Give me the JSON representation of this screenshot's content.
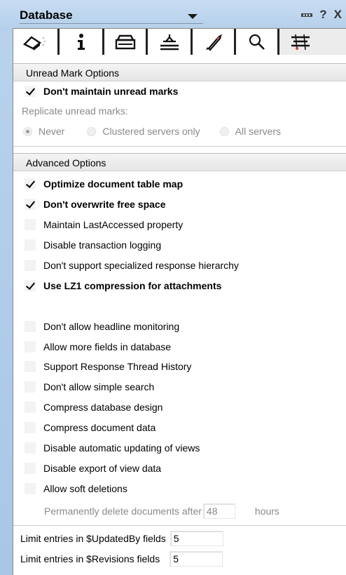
{
  "header": {
    "title": "Database",
    "help": "?",
    "close": "X"
  },
  "tabs": [
    {
      "icon": "info-tab-eraser-icon"
    },
    {
      "icon": "info-icon"
    },
    {
      "icon": "printer-icon"
    },
    {
      "icon": "design-icon"
    },
    {
      "icon": "rocket-icon"
    },
    {
      "icon": "search-icon"
    },
    {
      "icon": "advanced-icon"
    }
  ],
  "unread": {
    "header": "Unread Mark Options",
    "dont_maintain": "Don't maintain unread marks",
    "replicate_label": "Replicate unread marks:",
    "radios": [
      "Never",
      "Clustered servers only",
      "All servers"
    ],
    "selected": "Never"
  },
  "advanced": {
    "header": "Advanced Options",
    "options": [
      {
        "label": "Optimize document table map",
        "checked": true
      },
      {
        "label": "Don't overwrite free space",
        "checked": true
      },
      {
        "label": "Maintain LastAccessed property",
        "checked": false
      },
      {
        "label": "Disable transaction logging",
        "checked": false
      },
      {
        "label": "Don't support specialized response hierarchy",
        "checked": false
      },
      {
        "label": "Use LZ1 compression for attachments",
        "checked": true
      },
      {
        "label": "Don't allow headline monitoring",
        "checked": false
      },
      {
        "label": "Allow more fields in database",
        "checked": false
      },
      {
        "label": "Support Response Thread History",
        "checked": false
      },
      {
        "label": "Don't allow simple search",
        "checked": false
      },
      {
        "label": "Compress database design",
        "checked": false
      },
      {
        "label": "Compress document data",
        "checked": false
      },
      {
        "label": "Disable automatic updating of views",
        "checked": false
      },
      {
        "label": "Disable export of view data",
        "checked": false
      },
      {
        "label": "Allow soft deletions",
        "checked": false
      }
    ],
    "perm_delete_label": "Permanently delete documents after",
    "perm_delete_value": "48",
    "perm_delete_unit": "hours",
    "updatedby_label": "Limit entries in $UpdatedBy fields",
    "updatedby_value": "5",
    "revisions_label": "Limit entries in $Revisions fields",
    "revisions_value": "5"
  }
}
